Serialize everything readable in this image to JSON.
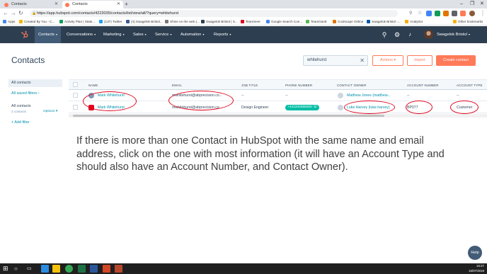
{
  "browser": {
    "tabs": [
      {
        "title": "Contacts",
        "active": false
      },
      {
        "title": "Contacts",
        "active": true
      }
    ],
    "new_tab_glyph": "+",
    "url": "https://app.hubspot.com/contacts/4223035/contacts/list/view/all/?query=whitehurst",
    "bookmarks": [
      {
        "label": "Apps",
        "icon_color": "#4285f4"
      },
      {
        "label": "Created By You - C...",
        "icon_color": "#f4b400"
      },
      {
        "label": "Activity Plan | Stats...",
        "icon_color": "#0f9d58"
      },
      {
        "label": "(137) Twitter",
        "icon_color": "#1da1f2"
      },
      {
        "label": "(4) Swagelok Bristol...",
        "icon_color": "#3b5998"
      },
      {
        "label": "Shine on the web |...",
        "icon_color": "#777777"
      },
      {
        "label": "Swagelok Bristol | S...",
        "icon_color": "#2d3e50"
      },
      {
        "label": "TeamSeer",
        "icon_color": "#e1051e"
      },
      {
        "label": "Google Search Con...",
        "icon_color": "#4285f4"
      },
      {
        "label": "TeamGantt",
        "icon_color": "#5ab75a"
      },
      {
        "label": "Coolscape Online",
        "icon_color": "#e37400"
      },
      {
        "label": "Swagelok Bristol -...",
        "icon_color": "#0057a8"
      },
      {
        "label": "Analytics",
        "icon_color": "#f9ab00"
      }
    ],
    "other_bookmarks": "Other bookmarks"
  },
  "hubspot_nav": {
    "items": [
      {
        "label": "Contacts",
        "active": true
      },
      {
        "label": "Conversations",
        "active": false
      },
      {
        "label": "Marketing",
        "active": false
      },
      {
        "label": "Sales",
        "active": false
      },
      {
        "label": "Service",
        "active": false
      },
      {
        "label": "Automation",
        "active": false
      },
      {
        "label": "Reports",
        "active": false
      }
    ],
    "account_name": "Swagelok Bristol"
  },
  "page": {
    "title": "Contacts",
    "search_value": "whitehurst",
    "actions_label": "Actions",
    "import_label": "Import",
    "create_label": "Create contact"
  },
  "sidebar": {
    "all_contacts": "All contacts",
    "all_saved_filters": "All saved filters",
    "filter_title": "All contacts",
    "filter_count": "2 contacts",
    "options": "Options",
    "add_filter": "Add filter"
  },
  "table": {
    "columns": [
      "NAME",
      "EMAIL",
      "JOB TITLE",
      "PHONE NUMBER",
      "CONTACT OWNER",
      "ACCOUNT NUMBER",
      "ACCOUNT TYPE"
    ],
    "rows": [
      {
        "name": "Mark Whitehurst",
        "email": "mwhitehurst@abprecision.co...",
        "job_title": "--",
        "phone": "--",
        "owner": "Matthew Jones (matthew...",
        "account_number": "--",
        "account_type": "--"
      },
      {
        "name": "Mark Whitehurst",
        "email": "mwhitehurst@abprecision.co...",
        "job_title": "Design Engineer",
        "phone": "+441202665000",
        "owner": "Luke Harvey (luke.harvey)",
        "account_number": "BP077",
        "account_type": "Customer"
      }
    ]
  },
  "caption": "If there is more than one Contact in HubSpot with the same name and email address, click on the one with most information (it will have an Account Type and should also have an Account Number, and Contact Owner).",
  "help_label": "Help",
  "taskbar": {
    "time": "16:27",
    "date": "16/07/2019"
  },
  "colors": {
    "hubspot_nav": "#2d3e50",
    "accent": "#ff7a59",
    "link": "#0091ae",
    "annotation": "#e1051e",
    "phone_badge": "#00bda5"
  }
}
